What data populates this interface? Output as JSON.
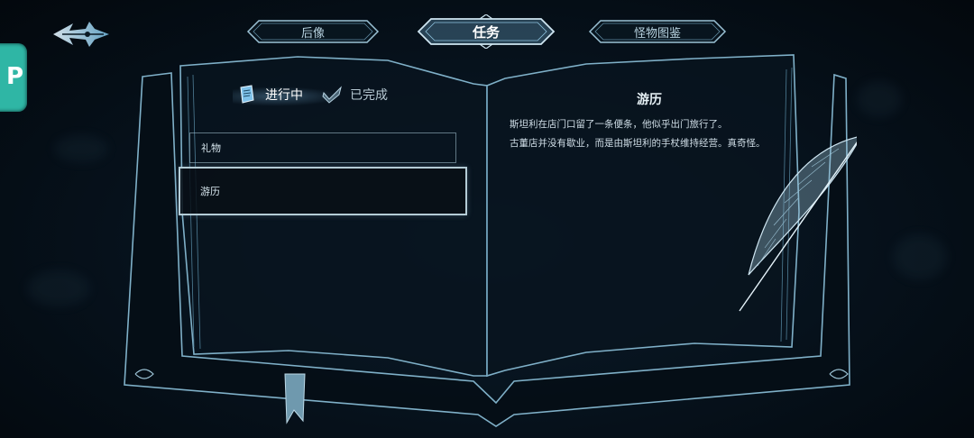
{
  "tabs": [
    {
      "label": "后像"
    },
    {
      "label": "任务"
    },
    {
      "label": "怪物图鉴"
    }
  ],
  "active_tab": "任务",
  "side_badge": {
    "text": "P"
  },
  "quest_log": {
    "status_tabs": [
      {
        "label": "进行中"
      },
      {
        "label": "已完成"
      }
    ],
    "items": [
      {
        "label": "礼物"
      },
      {
        "label": "游历"
      }
    ],
    "detail": {
      "title": "游历",
      "lines": [
        "斯坦利在店门口留了一条便条，他似乎出门旅行了。",
        "古董店并没有歇业，而是由斯坦利的手杖维持经营。真奇怪。"
      ]
    }
  },
  "colors": {
    "accent": "#8fc4e0",
    "frame": "#9cc3d6",
    "background": "#050d15"
  }
}
